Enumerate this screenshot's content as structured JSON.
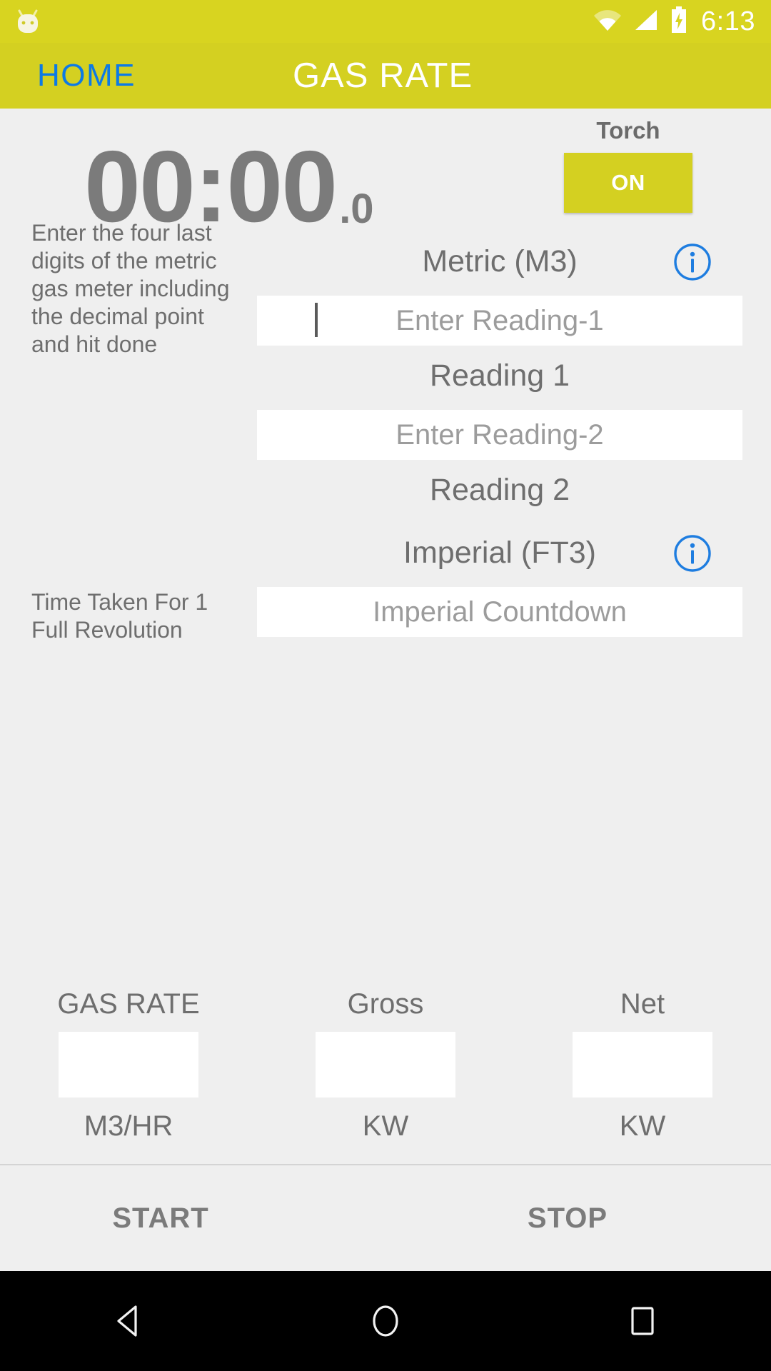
{
  "status_bar": {
    "clock": "6:13",
    "icons": [
      "android-mascot-icon",
      "wifi-icon",
      "cell-signal-icon",
      "battery-charging-icon"
    ],
    "background_color": "#d8d420",
    "foreground_color": "#ffffff"
  },
  "action_bar": {
    "home_tab_label": "HOME",
    "home_tab_color": "#0d7ae5",
    "title": "GAS RATE",
    "title_color": "#ffffff",
    "background_color": "#d4d021"
  },
  "timer": {
    "main": "00:00",
    "decimal": ".0",
    "color": "#7b7b7b"
  },
  "torch": {
    "label": "Torch",
    "state_label": "ON",
    "button_color": "#d4d021"
  },
  "metric_section": {
    "unit_label": "Metric (M3)",
    "info_icon": "info-circle-icon",
    "info_icon_color": "#1e7de0",
    "hint": "Enter the four last digits of the metric gas meter including the decimal point and hit done",
    "reading1_placeholder": "Enter Reading-1",
    "reading1_value": "",
    "reading1_label": "Reading 1",
    "reading2_placeholder": "Enter Reading-2",
    "reading2_value": "",
    "reading2_label": "Reading 2"
  },
  "imperial_section": {
    "unit_label": "Imperial (FT3)",
    "info_icon": "info-circle-icon",
    "info_icon_color": "#1e7de0",
    "hint": "Time Taken For 1 Full Revolution",
    "countdown_placeholder": "Imperial Countdown",
    "countdown_value": ""
  },
  "results": [
    {
      "title": "GAS RATE",
      "value": "",
      "unit": "M3/HR"
    },
    {
      "title": "Gross",
      "value": "",
      "unit": "KW"
    },
    {
      "title": "Net",
      "value": "",
      "unit": "KW"
    }
  ],
  "buttons": {
    "start_label": "START",
    "stop_label": "STOP"
  },
  "nav_bar": {
    "back_icon": "back-triangle-icon",
    "home_icon": "home-circle-icon",
    "recents_icon": "recents-square-icon",
    "background_color": "#000000"
  }
}
